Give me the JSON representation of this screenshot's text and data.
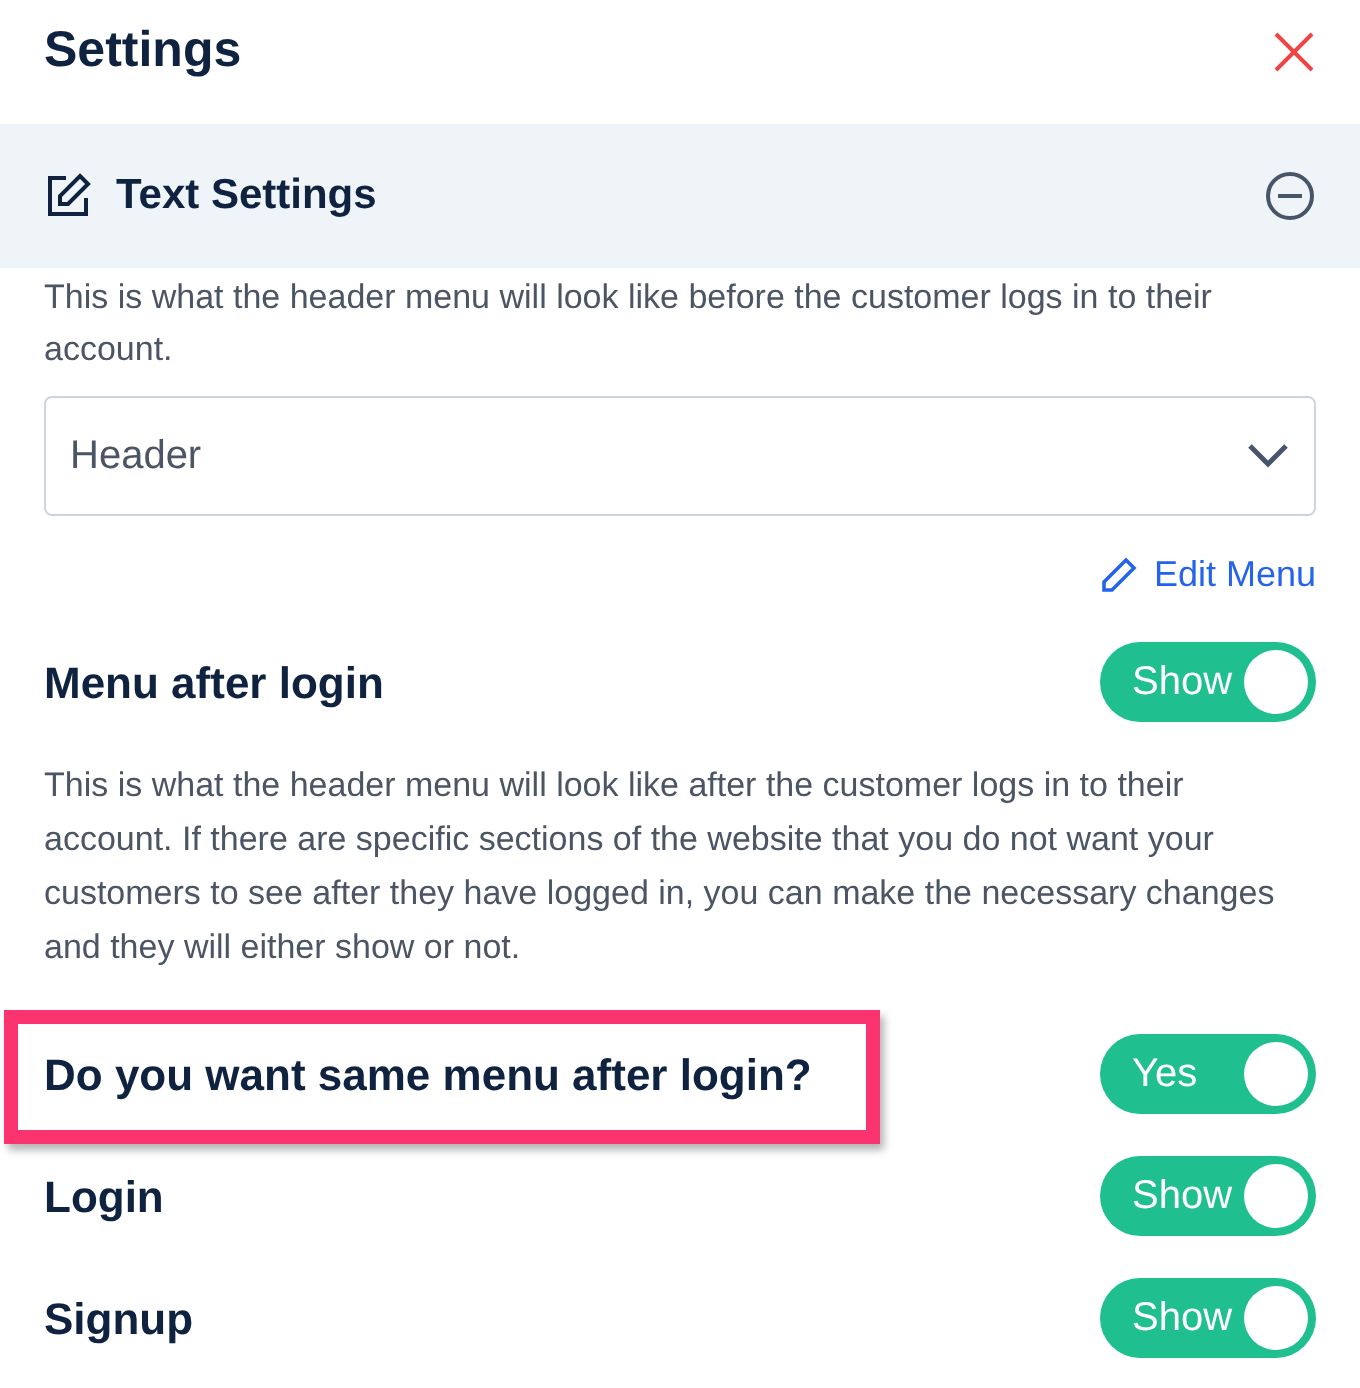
{
  "title": "Settings",
  "section": {
    "title": "Text Settings",
    "expanded": true
  },
  "before_login": {
    "description": "This is what the header menu will look like before the customer logs in to their account.",
    "menu_select": {
      "value": "Header"
    },
    "edit_link": "Edit Menu"
  },
  "menu_after_login": {
    "label": "Menu after login",
    "toggle": {
      "on": true,
      "label": "Show"
    },
    "description": "This is what the header menu will look like after the customer logs in to their account. If there are specific sections of the website that you do not want your customers to see after they have logged in, you can make the necessary changes and they will either show or not."
  },
  "options": [
    {
      "label": "Do you want same menu after login?",
      "highlighted": true,
      "toggle": {
        "on": true,
        "label": "Yes"
      }
    },
    {
      "label": "Login",
      "highlighted": false,
      "toggle": {
        "on": true,
        "label": "Show"
      }
    },
    {
      "label": "Signup",
      "highlighted": false,
      "toggle": {
        "on": true,
        "label": "Show"
      }
    }
  ]
}
